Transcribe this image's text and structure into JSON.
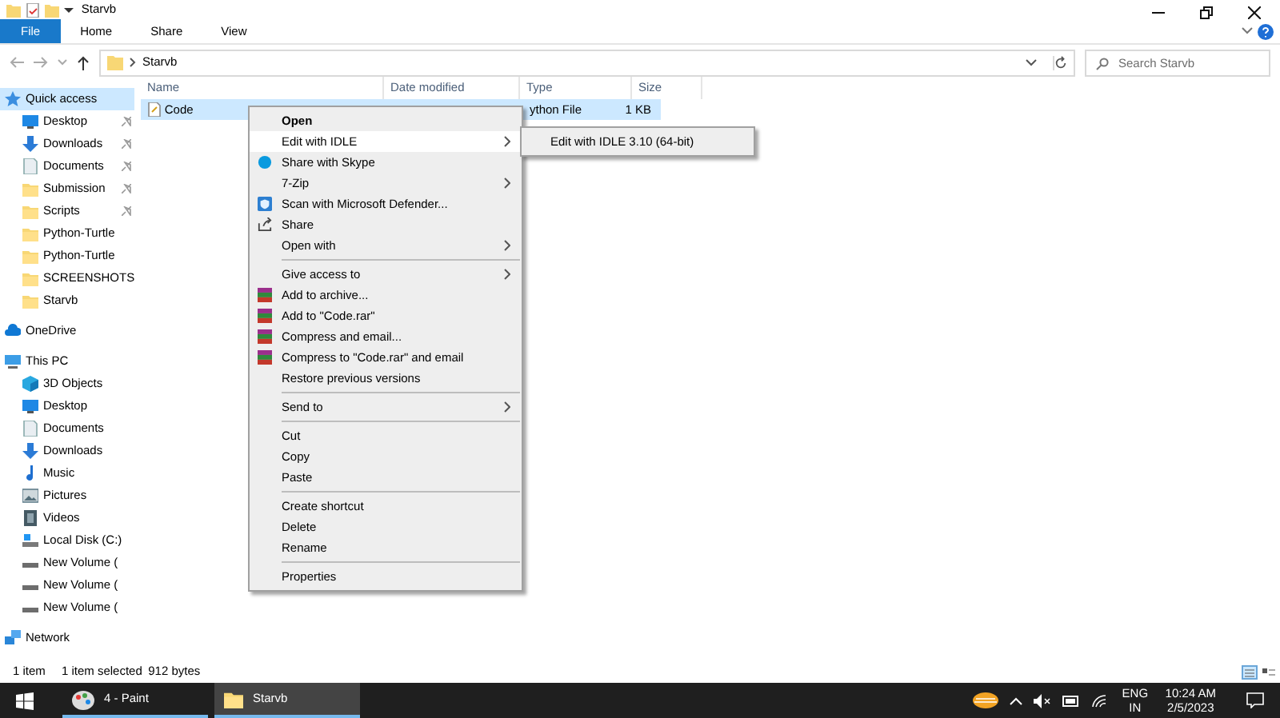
{
  "window": {
    "title": "Starvb"
  },
  "ribbon_tabs": [
    {
      "label": "File",
      "kind": "file",
      "selected": false
    },
    {
      "label": "Home",
      "kind": "tab",
      "selected": false
    },
    {
      "label": "Share",
      "kind": "tab",
      "selected": false
    },
    {
      "label": "View",
      "kind": "tab",
      "selected": false
    }
  ],
  "address": {
    "path": "Starvb"
  },
  "search": {
    "placeholder": "Search Starvb"
  },
  "sidebar": {
    "items": [
      {
        "label": "Quick access",
        "kind": "star",
        "selected": true,
        "children": [
          {
            "label": "Desktop",
            "kind": "desktop",
            "pinned": true
          },
          {
            "label": "Downloads",
            "kind": "download",
            "pinned": true
          },
          {
            "label": "Documents",
            "kind": "document",
            "pinned": true
          },
          {
            "label": "Submission",
            "kind": "folder",
            "pinned": true
          },
          {
            "label": "Scripts",
            "kind": "folder",
            "pinned": true
          },
          {
            "label": "Python-Turtle",
            "kind": "folder",
            "pinned": false
          },
          {
            "label": "Python-Turtle",
            "kind": "folder",
            "pinned": false
          },
          {
            "label": "SCREENSHOTS",
            "kind": "folder",
            "pinned": false
          },
          {
            "label": "Starvb",
            "kind": "folder",
            "pinned": false
          }
        ]
      },
      {
        "label": "OneDrive",
        "kind": "cloud",
        "selected": false
      },
      {
        "label": "This PC",
        "kind": "pc",
        "selected": false,
        "children": [
          {
            "label": "3D Objects",
            "kind": "cube",
            "pinned": false
          },
          {
            "label": "Desktop",
            "kind": "desktop",
            "pinned": false
          },
          {
            "label": "Documents",
            "kind": "document",
            "pinned": false
          },
          {
            "label": "Downloads",
            "kind": "download",
            "pinned": false
          },
          {
            "label": "Music",
            "kind": "music",
            "pinned": false
          },
          {
            "label": "Pictures",
            "kind": "pictures",
            "pinned": false
          },
          {
            "label": "Videos",
            "kind": "videos",
            "pinned": false
          },
          {
            "label": "Local Disk (C:)",
            "kind": "disk",
            "pinned": false
          },
          {
            "label": "New Volume (",
            "kind": "drive",
            "pinned": false
          },
          {
            "label": "New Volume (",
            "kind": "drive",
            "pinned": false
          },
          {
            "label": "New Volume (",
            "kind": "drive",
            "pinned": false
          }
        ]
      },
      {
        "label": "Network",
        "kind": "network",
        "selected": false
      }
    ]
  },
  "file_list": {
    "columns": [
      "Name",
      "Date modified",
      "Type",
      "Size"
    ],
    "rows": [
      {
        "name": "Code",
        "type": "ython File",
        "size": "1 KB",
        "selected": true
      }
    ]
  },
  "context_menu": {
    "items": [
      {
        "kind": "default",
        "label": "Open",
        "submenu": false,
        "selected": false
      },
      {
        "kind": "item",
        "label": "Edit with IDLE",
        "submenu": true,
        "selected": true
      },
      {
        "kind": "skype",
        "label": "Share with Skype",
        "submenu": false,
        "selected": false
      },
      {
        "kind": "item",
        "label": "7-Zip",
        "submenu": true,
        "selected": false
      },
      {
        "kind": "defender",
        "label": "Scan with Microsoft Defender...",
        "submenu": false,
        "selected": false
      },
      {
        "kind": "share",
        "label": "Share",
        "submenu": false,
        "selected": false
      },
      {
        "kind": "item",
        "label": "Open with",
        "submenu": true,
        "selected": false
      },
      {
        "kind": "separator"
      },
      {
        "kind": "item",
        "label": "Give access to",
        "submenu": true,
        "selected": false
      },
      {
        "kind": "archive",
        "label": "Add to archive...",
        "submenu": false,
        "selected": false
      },
      {
        "kind": "archive",
        "label": "Add to \"Code.rar\"",
        "submenu": false,
        "selected": false
      },
      {
        "kind": "archive",
        "label": "Compress and email...",
        "submenu": false,
        "selected": false
      },
      {
        "kind": "archive",
        "label": "Compress to \"Code.rar\" and email",
        "submenu": false,
        "selected": false
      },
      {
        "kind": "item",
        "label": "Restore previous versions",
        "submenu": false,
        "selected": false
      },
      {
        "kind": "separator"
      },
      {
        "kind": "item",
        "label": "Send to",
        "submenu": true,
        "selected": false
      },
      {
        "kind": "separator"
      },
      {
        "kind": "item",
        "label": "Cut",
        "submenu": false,
        "selected": false
      },
      {
        "kind": "item",
        "label": "Copy",
        "submenu": false,
        "selected": false
      },
      {
        "kind": "item",
        "label": "Paste",
        "submenu": false,
        "selected": false
      },
      {
        "kind": "separator"
      },
      {
        "kind": "item",
        "label": "Create shortcut",
        "submenu": false,
        "selected": false
      },
      {
        "kind": "item",
        "label": "Delete",
        "submenu": false,
        "selected": false
      },
      {
        "kind": "item",
        "label": "Rename",
        "submenu": false,
        "selected": false
      },
      {
        "kind": "separator"
      },
      {
        "kind": "item",
        "label": "Properties",
        "submenu": false,
        "selected": false
      }
    ]
  },
  "submenu": {
    "items": [
      {
        "label": "Edit with IDLE 3.10 (64-bit)"
      }
    ]
  },
  "status_bar": {
    "count": "1 item",
    "selection": "1 item selected",
    "size": "912 bytes"
  },
  "taskbar": {
    "apps": [
      {
        "label": "4 - Paint",
        "kind": "paint",
        "selected": false
      },
      {
        "label": "Starvb",
        "kind": "folder",
        "selected": true
      }
    ],
    "language": "ENG",
    "region": "IN",
    "time": "10:24 AM",
    "date": "2/5/2023"
  }
}
